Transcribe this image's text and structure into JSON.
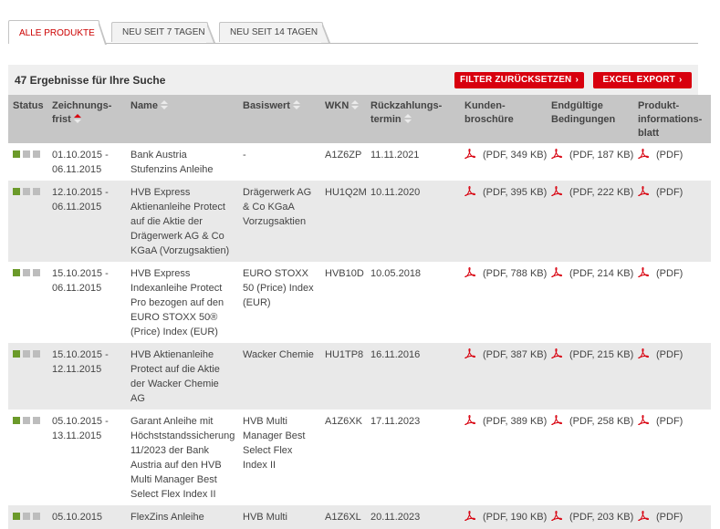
{
  "tabs": [
    {
      "label": "ALLE PRODUKTE",
      "active": true
    },
    {
      "label": "NEU SEIT 7 TAGEN",
      "active": false
    },
    {
      "label": "NEU SEIT 14 TAGEN",
      "active": false
    }
  ],
  "results": {
    "count_label": "47 Ergebnisse für Ihre Suche",
    "reset_filter": "FILTER ZURÜCKSETZEN",
    "excel_export": "EXCEL EXPORT",
    "arrow": "›"
  },
  "columns": [
    "Status",
    "Zeichnungs-frist",
    "Name",
    "Basiswert",
    "WKN",
    "Rückzahlungs-termin",
    "Kunden-broschüre",
    "Endgültige Bedingungen",
    "Produkt-informations-blatt"
  ],
  "rows": [
    {
      "period": "01.10.2015 - 06.11.2015",
      "name": "Bank Austria Stufenzins Anleihe",
      "underlying": "-",
      "wkn": "A1Z6ZP",
      "repayment": "11.11.2021",
      "brochure": "(PDF, 349 KB)",
      "terms": "(PDF, 187 KB)",
      "info": "(PDF)"
    },
    {
      "period": "12.10.2015 - 06.11.2015",
      "name": "HVB Express Aktienanleihe Protect auf die Aktie der Drägerwerk AG & Co KGaA (Vorzugsaktien)",
      "underlying": "Drägerwerk AG & Co KGaA Vorzugsaktien",
      "wkn": "HU1Q2M",
      "repayment": "10.11.2020",
      "brochure": "(PDF, 395 KB)",
      "terms": "(PDF, 222 KB)",
      "info": "(PDF)"
    },
    {
      "period": "15.10.2015 - 06.11.2015",
      "name": "HVB Express Indexanleihe Protect Pro bezogen auf den EURO STOXX 50® (Price) Index (EUR)",
      "underlying": "EURO STOXX 50 (Price) Index (EUR)",
      "wkn": "HVB10D",
      "repayment": "10.05.2018",
      "brochure": "(PDF, 788 KB)",
      "terms": "(PDF, 214 KB)",
      "info": "(PDF)"
    },
    {
      "period": "15.10.2015 - 12.11.2015",
      "name": "HVB Aktienanleihe Protect auf die Aktie der Wacker Chemie AG",
      "underlying": "Wacker Chemie",
      "wkn": "HU1TP8",
      "repayment": "16.11.2016",
      "brochure": "(PDF, 387 KB)",
      "terms": "(PDF, 215 KB)",
      "info": "(PDF)"
    },
    {
      "period": "05.10.2015 - 13.11.2015",
      "name": "Garant Anleihe mit Höchststandssicherung 11/2023 der Bank Austria auf den HVB Multi Manager Best Select Flex Index II",
      "underlying": "HVB Multi Manager Best Select Flex Index II",
      "wkn": "A1Z6XK",
      "repayment": "17.11.2023",
      "brochure": "(PDF, 389 KB)",
      "terms": "(PDF, 258 KB)",
      "info": "(PDF)"
    },
    {
      "period": "05.10.2015",
      "name": "FlexZins Anleihe",
      "underlying": "HVB Multi",
      "wkn": "A1Z6XL",
      "repayment": "20.11.2023",
      "brochure": "(PDF, 190 KB)",
      "terms": "(PDF, 203 KB)",
      "info": "(PDF)"
    }
  ],
  "colors": {
    "accent": "#d8000e",
    "status_on": "#6b9a2a",
    "status_off": "#bdbdbd"
  },
  "icons": {
    "pdf": "pdf-icon",
    "sort": "sort-arrows-icon"
  }
}
